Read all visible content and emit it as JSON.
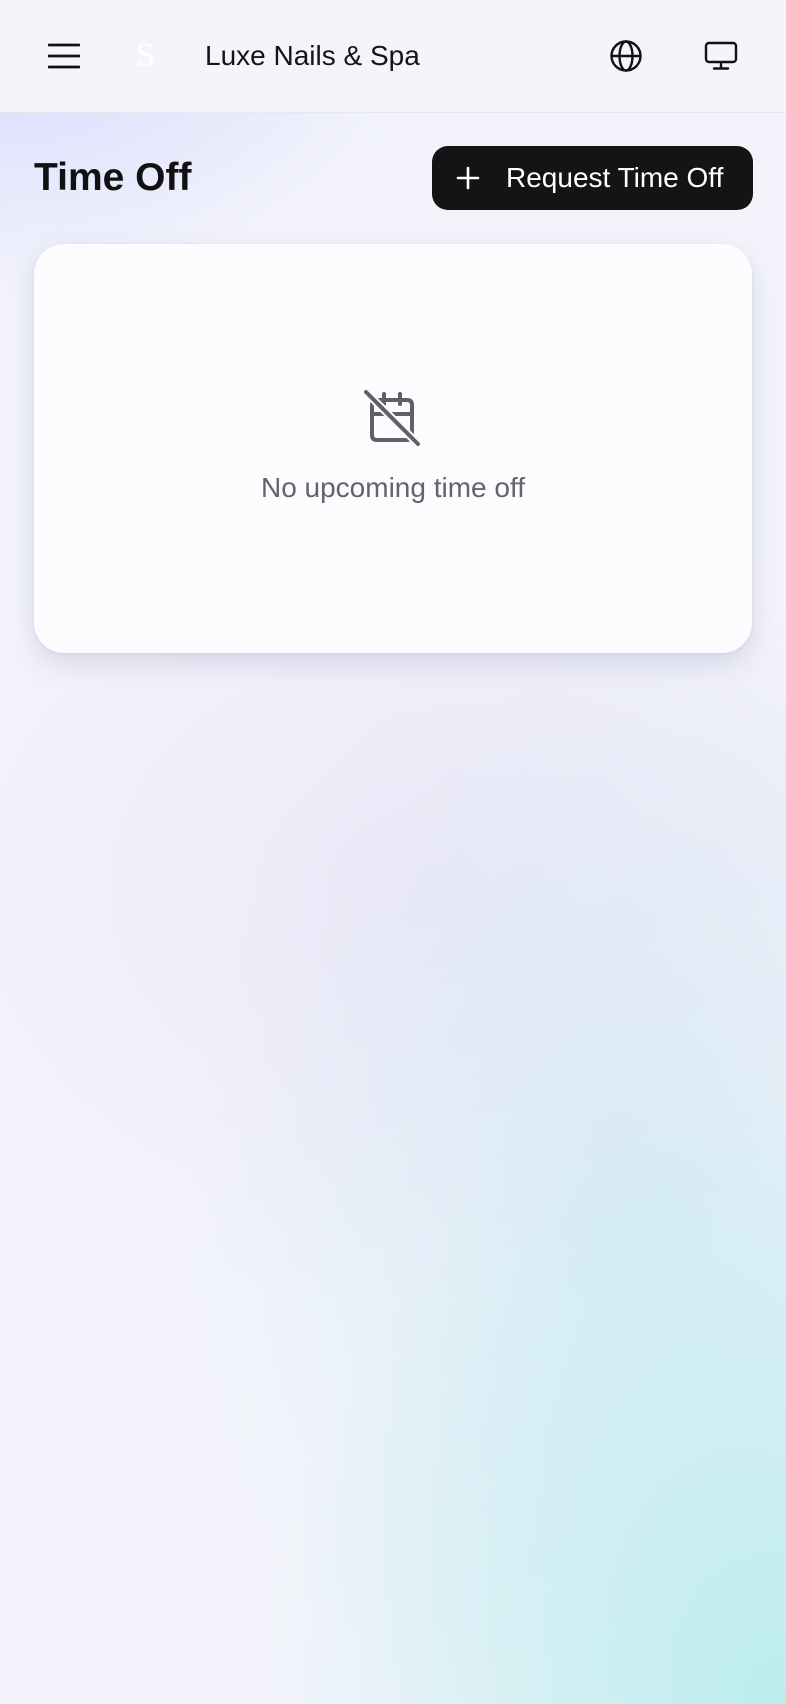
{
  "header": {
    "menu_icon": "hamburger-menu-icon",
    "logo_glyph": "S",
    "app_name": "Luxe Nails & Spa",
    "language_icon": "globe-icon",
    "display_icon": "monitor-icon"
  },
  "page": {
    "title": "Time Off"
  },
  "actions": {
    "request_button_label": "Request Time Off",
    "request_button_icon": "plus-icon"
  },
  "empty_state": {
    "icon": "calendar-off-icon",
    "message": "No upcoming time off"
  },
  "colors": {
    "button_background": "#141414",
    "button_text": "#ffffff",
    "muted_text": "#62636b",
    "card_background": "#fcfcfe"
  }
}
